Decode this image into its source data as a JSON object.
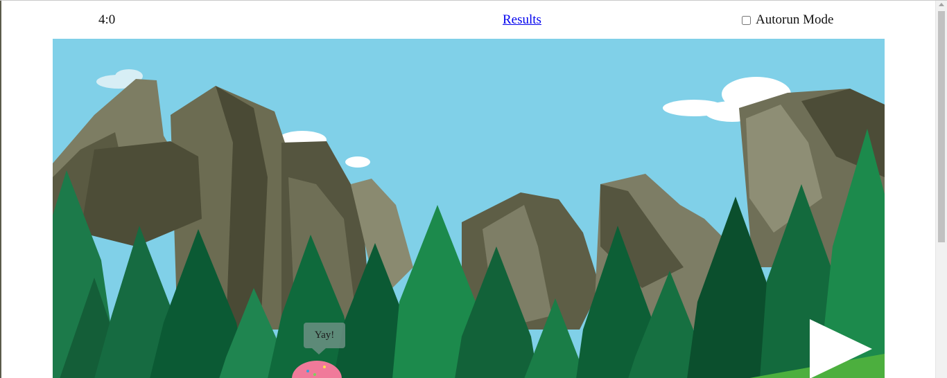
{
  "header": {
    "score": "4:0",
    "results_link": "Results",
    "autorun_label": "Autorun Mode",
    "autorun_checked": false
  },
  "game": {
    "speech_bubble": "Yay!",
    "character": "donut-character",
    "play_icon": "play-icon",
    "colors": {
      "sky": "#80d0e8",
      "rock": "#77775f",
      "rock_dark": "#45452f",
      "tree_dark": "#0b5a34",
      "tree_light": "#1c8a4c",
      "grass": "#4caf3e",
      "donut": "#f07a9a"
    }
  }
}
